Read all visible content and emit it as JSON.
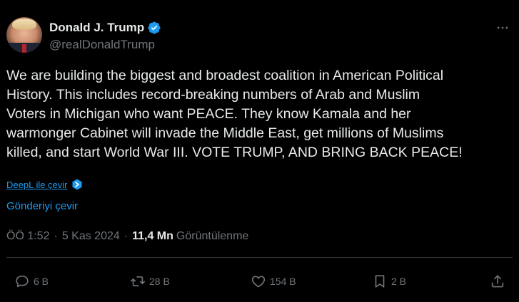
{
  "author": {
    "display_name": "Donald J. Trump",
    "handle": "@realDonaldTrump",
    "verified": true,
    "verified_color": "#1d9bf0"
  },
  "tweet": {
    "text": "We are building the biggest and broadest coalition in American Political\nHistory. This includes record-breaking numbers of Arab and Muslim\nVoters in Michigan who want PEACE. They know Kamala and her\nwarmonger Cabinet will invade the Middle East, get millions of Muslims\nkilled, and start World War III. VOTE TRUMP, AND BRING BACK PEACE!"
  },
  "translate": {
    "deepl_label": "DeepL ile çevir",
    "post_label": "Gönderiyi çevir"
  },
  "meta": {
    "time": "ÖÖ 1:52",
    "separator": "·",
    "date": "5 Kas 2024",
    "views_count": "11,4 Mn",
    "views_label": "Görüntülenme"
  },
  "actions": {
    "replies": "6 B",
    "reposts": "28 B",
    "likes": "154 B",
    "bookmarks": "2 B"
  },
  "colors": {
    "background": "#000000",
    "text": "#e7e9ea",
    "muted": "#71767b",
    "link": "#1d9bf0"
  }
}
